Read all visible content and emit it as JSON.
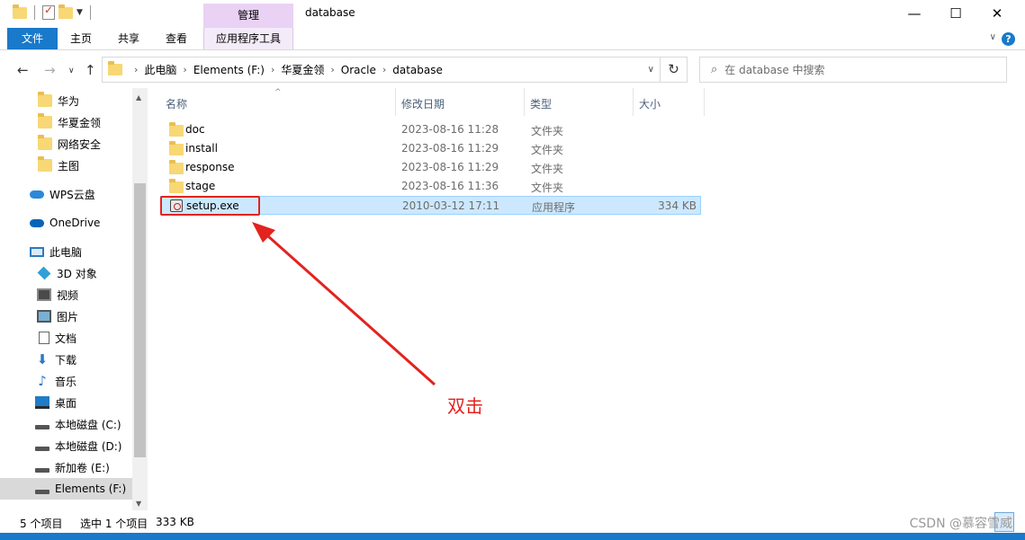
{
  "window": {
    "title": "database",
    "context_tab": "管理",
    "minimize": "—",
    "maximize": "☐",
    "close": "✕"
  },
  "ribbon": {
    "tabs": [
      "文件",
      "主页",
      "共享",
      "查看",
      "应用程序工具"
    ]
  },
  "address": {
    "crumbs": [
      "此电脑",
      "Elements (F:)",
      "华夏金领",
      "Oracle",
      "database"
    ],
    "search_placeholder": "在 database 中搜索"
  },
  "sidebar": {
    "items": [
      {
        "label": "华为",
        "icon": "folder-icon"
      },
      {
        "label": "华夏金领",
        "icon": "folder-icon"
      },
      {
        "label": "网络安全",
        "icon": "folder-icon"
      },
      {
        "label": "主图",
        "icon": "folder-icon"
      },
      {
        "label": "WPS云盘",
        "icon": "cloud-icon"
      },
      {
        "label": "OneDrive",
        "icon": "onedrive-icon"
      },
      {
        "label": "此电脑",
        "icon": "pc-icon"
      },
      {
        "label": "3D 对象",
        "icon": "3d-objects-icon"
      },
      {
        "label": "视频",
        "icon": "video-icon"
      },
      {
        "label": "图片",
        "icon": "pictures-icon"
      },
      {
        "label": "文档",
        "icon": "documents-icon"
      },
      {
        "label": "下载",
        "icon": "download-icon"
      },
      {
        "label": "音乐",
        "icon": "music-icon"
      },
      {
        "label": "桌面",
        "icon": "desktop-icon"
      },
      {
        "label": "本地磁盘 (C:)",
        "icon": "drive-icon"
      },
      {
        "label": "本地磁盘 (D:)",
        "icon": "drive-icon"
      },
      {
        "label": "新加卷 (E:)",
        "icon": "drive-icon"
      },
      {
        "label": "Elements (F:)",
        "icon": "drive-icon"
      }
    ]
  },
  "columns": {
    "name": "名称",
    "date": "修改日期",
    "type": "类型",
    "size": "大小"
  },
  "files": [
    {
      "name": "doc",
      "date": "2023-08-16 11:28",
      "type": "文件夹",
      "size": ""
    },
    {
      "name": "install",
      "date": "2023-08-16 11:29",
      "type": "文件夹",
      "size": ""
    },
    {
      "name": "response",
      "date": "2023-08-16 11:29",
      "type": "文件夹",
      "size": ""
    },
    {
      "name": "stage",
      "date": "2023-08-16 11:36",
      "type": "文件夹",
      "size": ""
    },
    {
      "name": "setup.exe",
      "date": "2010-03-12 17:11",
      "type": "应用程序",
      "size": "334 KB"
    }
  ],
  "annotation": {
    "text": "双击",
    "color": "#e3231f"
  },
  "status": {
    "count": "5 个项目",
    "selection": "选中 1 个项目",
    "sel_size": "333 KB"
  },
  "watermark": "CSDN @慕容雪威",
  "colors": {
    "accent": "#1979ca",
    "context_tab": "#e9d2f4",
    "selection": "#cce8ff"
  }
}
